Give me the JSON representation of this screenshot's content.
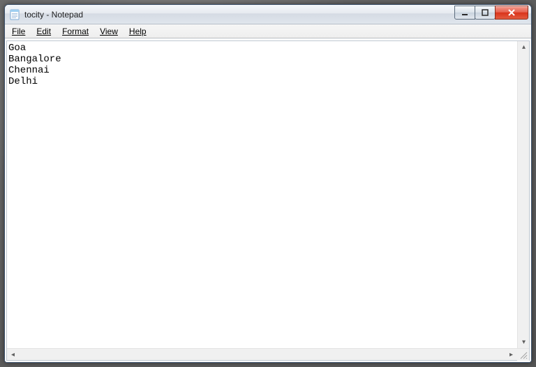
{
  "titlebar": {
    "title": "tocity - Notepad"
  },
  "menu": {
    "file": "File",
    "edit": "Edit",
    "format": "Format",
    "view": "View",
    "help": "Help"
  },
  "editor": {
    "content": "Goa\nBangalore\nChennai\nDelhi"
  }
}
